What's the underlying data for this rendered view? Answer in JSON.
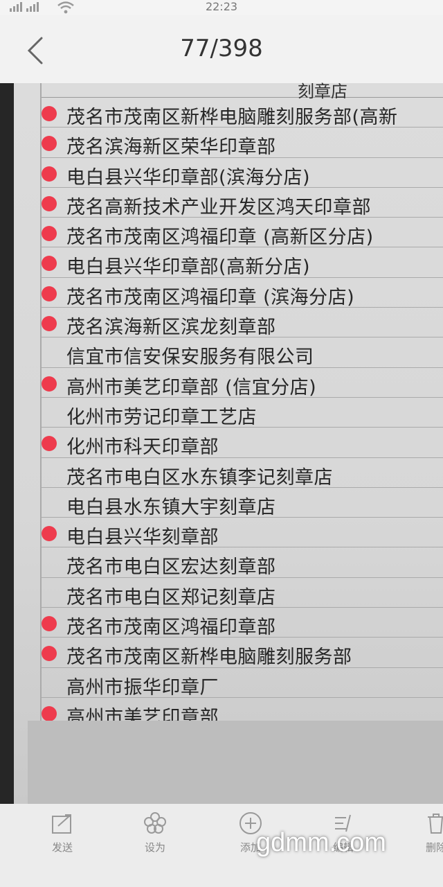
{
  "status": {
    "time": "22:23"
  },
  "header": {
    "page_indicator": "77/398"
  },
  "table": {
    "header_fragment": "刻章店",
    "rows": [
      {
        "text": "茂名市茂南区新桦电脑雕刻服务部(高新",
        "dot": true
      },
      {
        "text": "茂名滨海新区荣华印章部",
        "dot": true
      },
      {
        "text": "电白县兴华印章部(滨海分店)",
        "dot": true
      },
      {
        "text": "茂名高新技术产业开发区鸿天印章部",
        "dot": true
      },
      {
        "text": "茂名市茂南区鸿福印章 (高新区分店)",
        "dot": true
      },
      {
        "text": "电白县兴华印章部(高新分店)",
        "dot": true
      },
      {
        "text": "茂名市茂南区鸿福印章 (滨海分店)",
        "dot": true
      },
      {
        "text": "茂名滨海新区滨龙刻章部",
        "dot": true
      },
      {
        "text": "信宜市信安保安服务有限公司",
        "dot": false
      },
      {
        "text": "高州市美艺印章部 (信宜分店)",
        "dot": true
      },
      {
        "text": "化州市劳记印章工艺店",
        "dot": false
      },
      {
        "text": "化州市科天印章部",
        "dot": true
      },
      {
        "text": "茂名市电白区水东镇李记刻章店",
        "dot": false
      },
      {
        "text": "电白县水东镇大宇刻章店",
        "dot": false
      },
      {
        "text": "电白县兴华刻章部",
        "dot": true
      },
      {
        "text": "茂名市电白区宏达刻章部",
        "dot": false
      },
      {
        "text": "茂名市电白区郑记刻章店",
        "dot": false
      },
      {
        "text": "茂名市茂南区鸿福印章部",
        "dot": true
      },
      {
        "text": "茂名市茂南区新桦电脑雕刻服务部",
        "dot": true
      },
      {
        "text": "高州市振华印章厂",
        "dot": false
      },
      {
        "text": "高州市美艺印章部",
        "dot": true
      }
    ]
  },
  "toolbar": {
    "send_label": "发送",
    "set_as_label": "设为",
    "add_label": "添加",
    "edit_label": "编辑",
    "delete_label": "删除"
  },
  "watermark": "gdmm.com",
  "colors": {
    "dot": "#ee3b4d",
    "sheet": "#d9d9d9"
  }
}
